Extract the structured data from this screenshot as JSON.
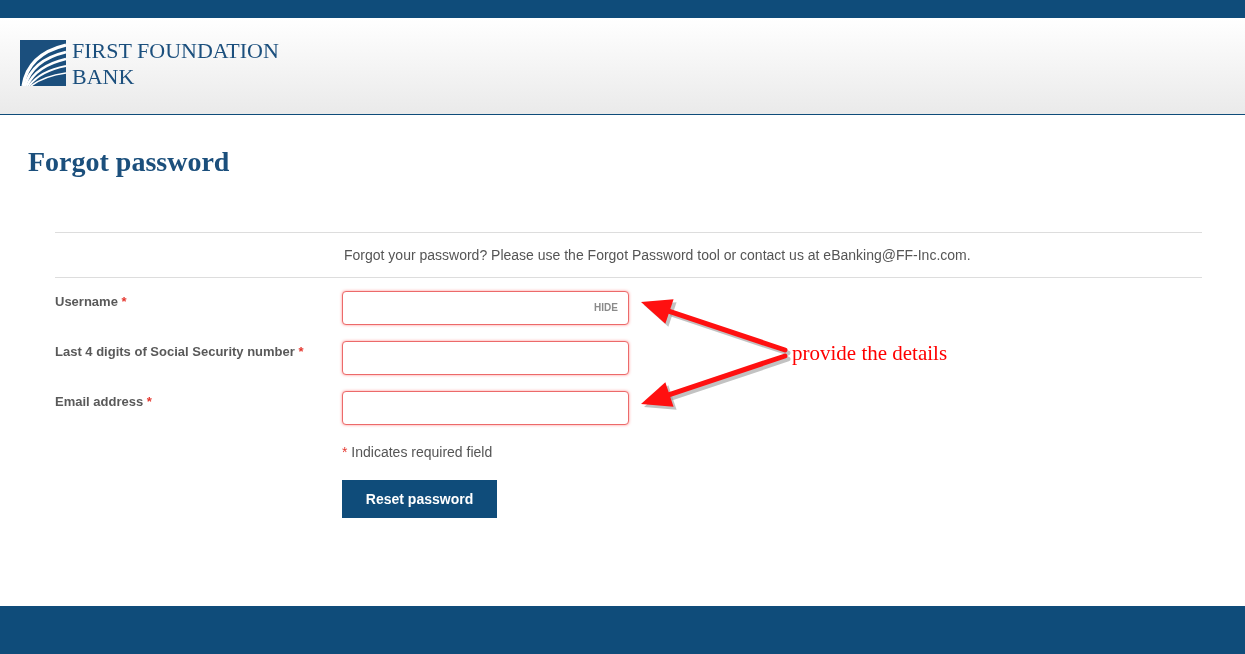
{
  "header": {
    "logo": {
      "line_1": "FIRST FOUNDATION",
      "line_2": "BANK"
    }
  },
  "page_title": "Forgot password",
  "notice": "Forgot your password? Please use the Forgot Password tool or contact us at eBanking@FF-Inc.com.",
  "fields": [
    {
      "label": "Username",
      "marker": "*",
      "invalid": true,
      "toggle": "HIDE"
    },
    {
      "label": "Last 4 digits of Social Security number",
      "marker": "*",
      "invalid": true
    },
    {
      "label": "Email address",
      "marker": "*",
      "invalid": true
    }
  ],
  "required_note": {
    "marker": "*",
    "text": "Indicates required field"
  },
  "submit_button": "Reset password",
  "annotation": {
    "text": "provide the details"
  }
}
